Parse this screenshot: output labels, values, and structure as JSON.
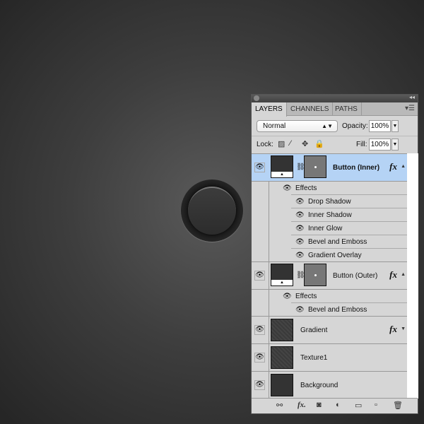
{
  "panel": {
    "tabs": [
      "LAYERS",
      "CHANNELS",
      "PATHS"
    ],
    "blend_mode": "Normal",
    "opacity_label": "Opacity:",
    "opacity": "100%",
    "lock_label": "Lock:",
    "fill_label": "Fill:",
    "fill": "100%",
    "layers": [
      {
        "name": "Button (Inner)",
        "selected": true,
        "fx": "fx",
        "effects_label": "Effects",
        "effects": [
          "Drop Shadow",
          "Inner Shadow",
          "Inner Glow",
          "Bevel and Emboss",
          "Gradient Overlay"
        ]
      },
      {
        "name": "Button (Outer)",
        "fx": "fx",
        "effects_label": "Effects",
        "effects": [
          "Bevel and Emboss"
        ]
      },
      {
        "name": "Gradient",
        "fx": "fx"
      },
      {
        "name": "Texture1"
      },
      {
        "name": "Background"
      }
    ],
    "colors": {
      "selected": "#b5d3f5",
      "panel": "#d6d6d6"
    },
    "bottom_icons": [
      "link-icon",
      "fx-icon",
      "mask-icon",
      "adjustment-icon",
      "folder-icon",
      "new-layer-icon",
      "trash-icon"
    ]
  }
}
